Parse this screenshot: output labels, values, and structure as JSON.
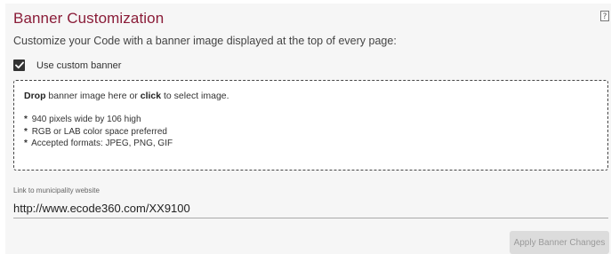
{
  "header": {
    "title": "Banner Customization",
    "help_label": "?",
    "subtitle": "Customize your Code with a banner image displayed at the top of every page:"
  },
  "custom_banner": {
    "checked": true,
    "label": "Use custom banner"
  },
  "dropzone": {
    "drop_word": "Drop",
    "text_middle": " banner image here or ",
    "click_word": "click",
    "text_end": " to select image.",
    "bullet_glyph": "*",
    "specs": [
      "940 pixels wide by 106 high",
      "RGB or LAB color space preferred",
      "Accepted formats: JPEG, PNG, GIF"
    ]
  },
  "website_link": {
    "label": "Link to municipality website",
    "value": "http://www.ecode360.com/XX9100"
  },
  "actions": {
    "apply_label": "Apply Banner Changes"
  },
  "colors": {
    "title": "#8a1c38",
    "panel_bg": "#f6f6f6",
    "button_bg": "#dcdcdc",
    "button_text": "#9a9a9a"
  },
  "icons": {
    "help": "help-icon",
    "checkbox": "checkmark-icon"
  }
}
